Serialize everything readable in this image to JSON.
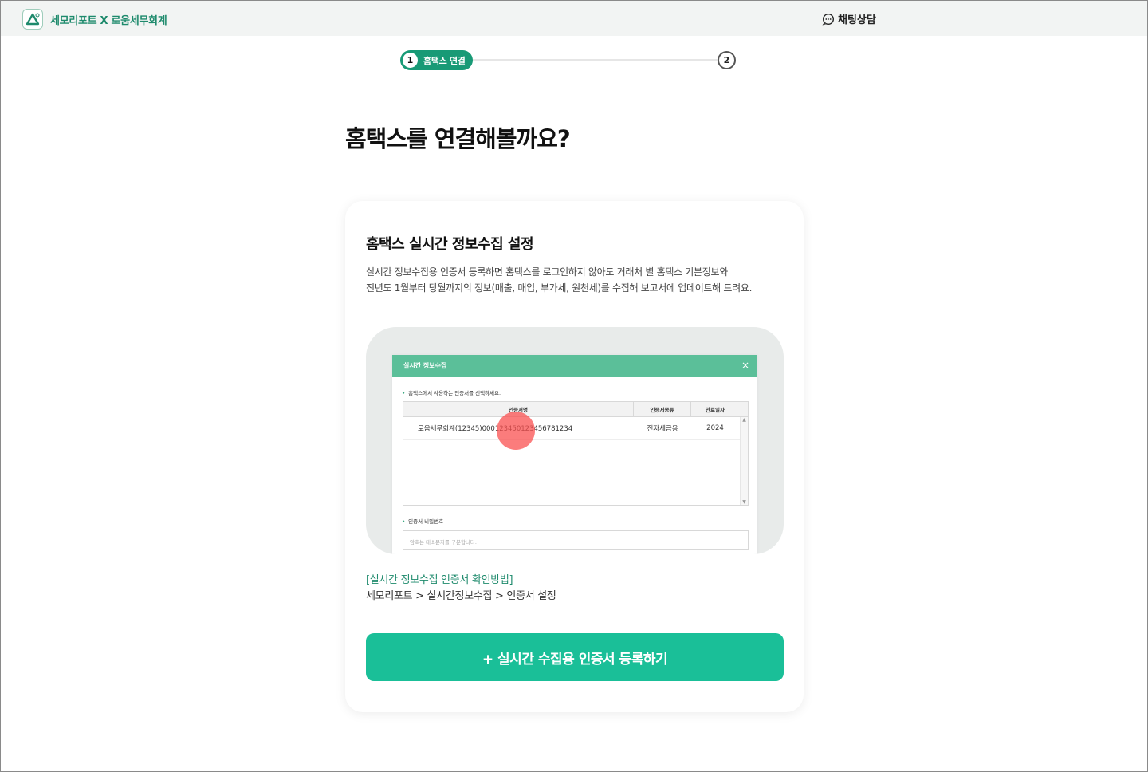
{
  "header": {
    "brand": "세모리포트 X 로움세무회계",
    "chat_label": "채팅상담"
  },
  "stepper": {
    "step1_number": "1",
    "step1_label": "홈택스 연결",
    "step2_number": "2"
  },
  "page_title": "홈택스를 연결해볼까요?",
  "card": {
    "title": "홈택스 실시간 정보수집 설정",
    "desc_line1": "실시간 정보수집용 인증서 등록하면 홈택스를 로그인하지 않아도 거래처 별 홈택스 기본정보와",
    "desc_line2": "전년도 1월부터 당월까지의 정보(매출, 매입, 부가세, 원천세)를 수집해 보고서에 업데이트해 드려요.",
    "illustration": {
      "modal_title": "실시간 정보수집",
      "close_glyph": "×",
      "hint": "홈택스에서 사용하는 인증서를 선택하세요.",
      "columns": [
        "인증서명",
        "인증서종류",
        "만료일자"
      ],
      "row": {
        "name": "로움세무회계(12345)0001234501234567812 34",
        "name_display": "로움세무회계(12345)00012345012345678 1234",
        "type": "전자세금용",
        "expiry": "2024"
      },
      "password_label": "인증서 비밀번호",
      "password_placeholder": "암호는 대소문자를 구분합니다."
    },
    "help_link": "[실시간 정보수집 인증서 확인방법]",
    "help_path": "세모리포트 > 실시간정보수집 > 인증서 설정",
    "register_button": "+ 실시간 수집용 인증서 등록하기"
  },
  "colors": {
    "brand_green": "#1e8a6c",
    "button_green": "#1abf98",
    "modal_header": "#5bbf99",
    "click_highlight": "#fa5050"
  }
}
